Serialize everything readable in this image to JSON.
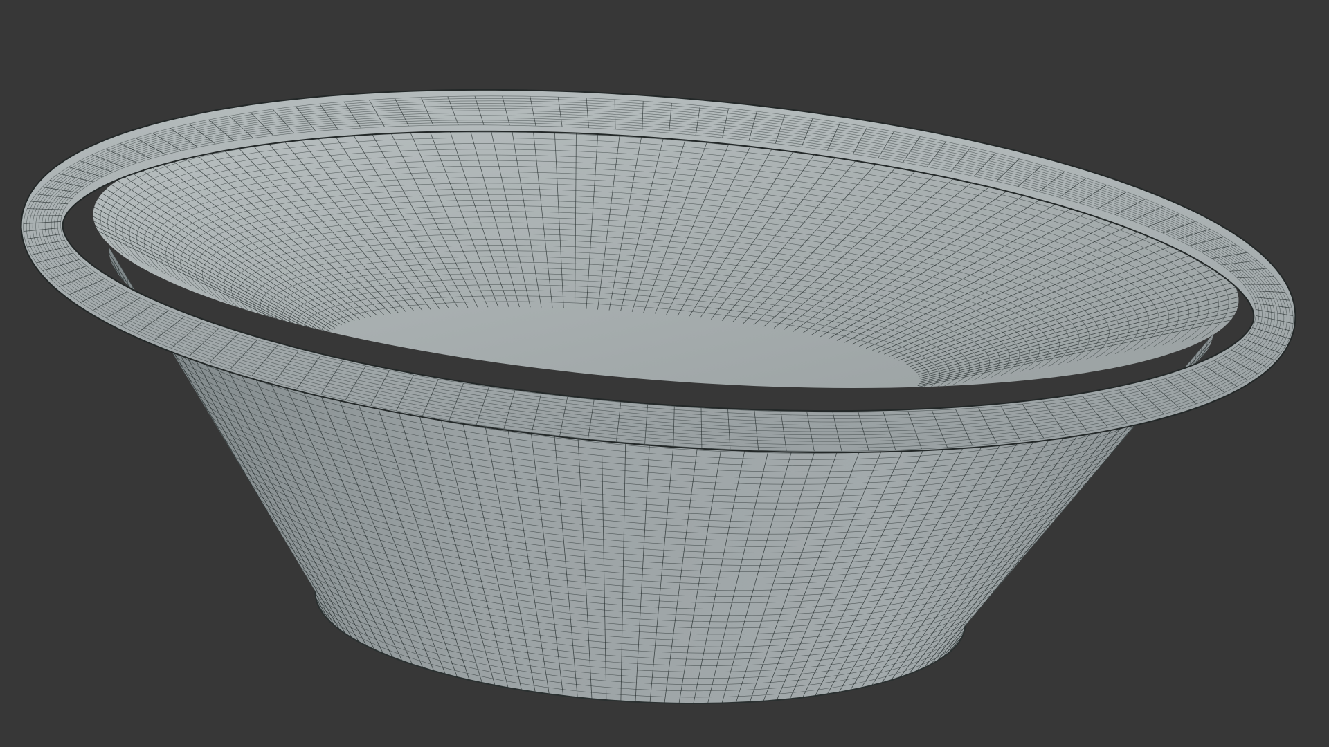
{
  "scene": {
    "background_color": "#373737",
    "mesh_color": "#a3aaab",
    "wire_color": "#1e2626"
  }
}
